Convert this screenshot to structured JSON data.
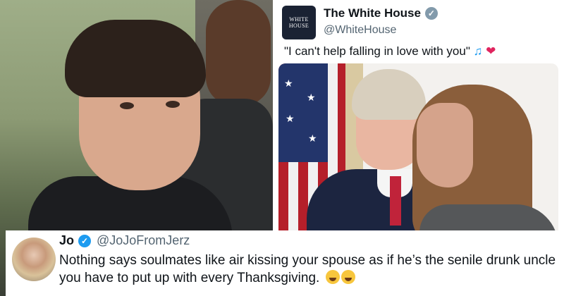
{
  "tweet": {
    "name": "The White House",
    "handle": "@WhiteHouse",
    "text": "\"I can't help falling in love with you\"",
    "avatar_logo_line1": "WHITE",
    "avatar_logo_line2": "HOUSE",
    "verified_color": "#829aab"
  },
  "reply": {
    "name": "Jo",
    "handle": "@JoJoFromJerz",
    "text": "Nothing says soulmates like air kissing your spouse as if he’s the senile drunk uncle you have to put up with every Thanksgiving.",
    "verified_color": "#1d9bf0"
  },
  "icons": {
    "music_notes": "music-notes-icon",
    "heart": "heart-icon",
    "laugh_emoji": "tears-of-joy-icon",
    "verified": "verified-badge-icon"
  }
}
